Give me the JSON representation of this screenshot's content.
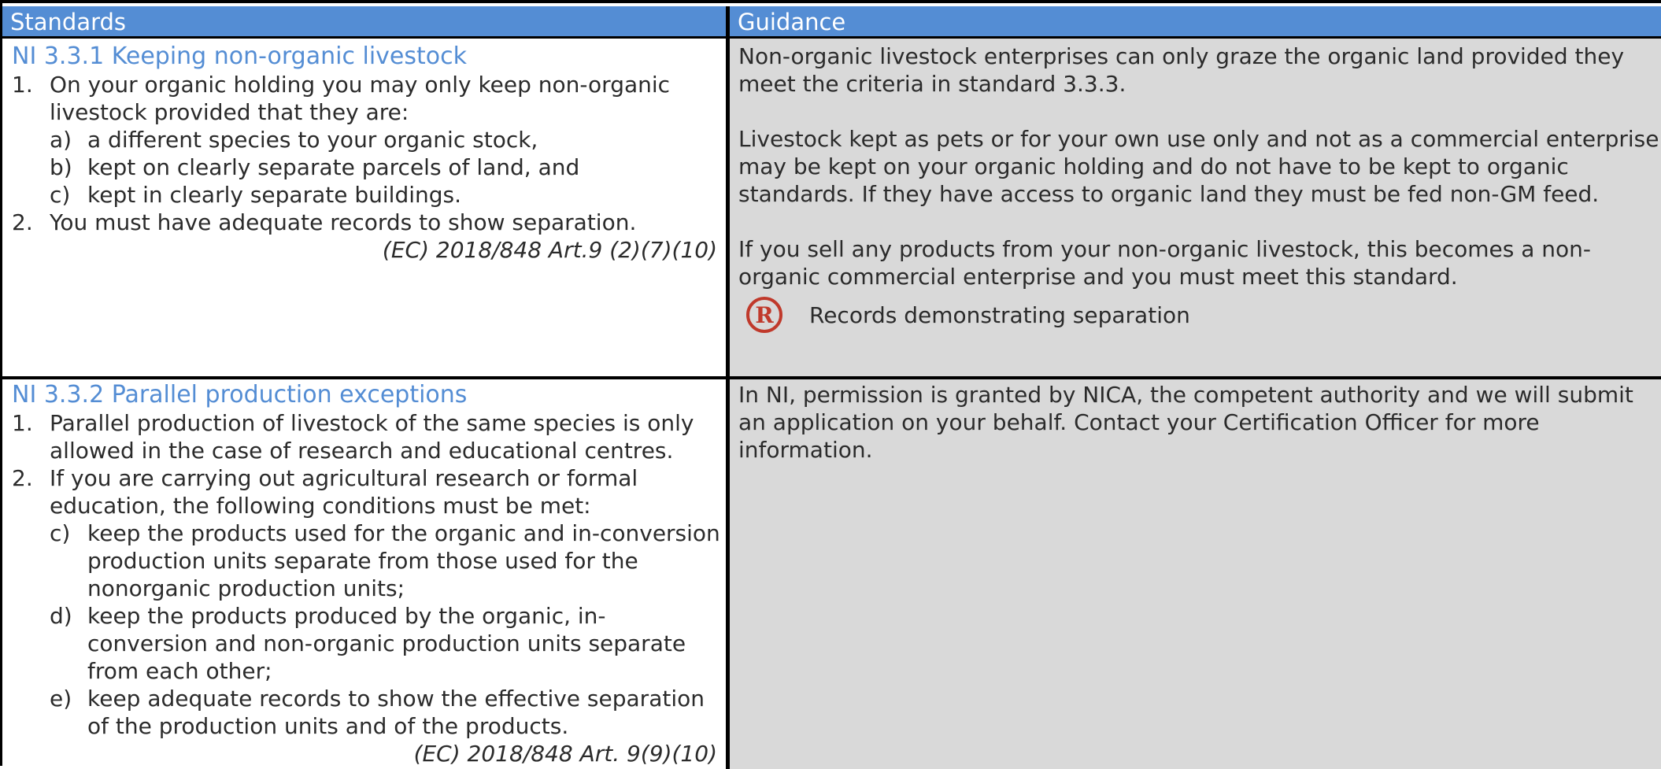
{
  "header": {
    "standards": "Standards",
    "guidance": "Guidance"
  },
  "section1": {
    "title": "NI 3.3.1 Keeping non-organic livestock",
    "items": [
      {
        "num": "1.",
        "text": "On your organic holding you may only keep non-organic livestock provided that they are:"
      },
      {
        "num": "2.",
        "text": "You must have adequate records to show separation."
      }
    ],
    "subitems": [
      {
        "num": "a)",
        "text": "a different species to your organic stock,"
      },
      {
        "num": "b)",
        "text": "kept on clearly separate parcels of land, and"
      },
      {
        "num": "c)",
        "text": "kept in clearly separate buildings."
      }
    ],
    "reference": "(EC) 2018/848 Art.9 (2)(7)(10)",
    "guidance": [
      "Non-organic livestock enterprises can only graze the organic land provided they meet the criteria in standard 3.3.3.",
      "Livestock kept as pets or for your own use only and not as a commercial enterprise may be kept on your organic holding and do not have to be kept to organic standards. If they have access to organic land they must be fed non-GM feed.",
      "If you sell any products from your non-organic livestock, this becomes a non-organic commercial enterprise and you must meet this standard."
    ],
    "records_icon": "R",
    "records_label": "Records demonstrating separation"
  },
  "section2": {
    "title": "NI 3.3.2 Parallel production exceptions",
    "items": [
      {
        "num": "1.",
        "text": "Parallel production of livestock of the same species is only allowed in the case of research and educational centres."
      },
      {
        "num": "2.",
        "text": "If you are carrying out agricultural research or formal education, the following conditions must be met:"
      }
    ],
    "subitems": [
      {
        "num": "c)",
        "text": "keep the products used for the organic and in-conversion production units separate from those used for the nonorganic production units;"
      },
      {
        "num": "d)",
        "text": "keep the products produced by the organic, in-conversion and non-organic production units separate from each other;"
      },
      {
        "num": "e)",
        "text": "keep adequate records to show the effective separation of the production units and of the products."
      }
    ],
    "reference": "(EC) 2018/848 Art. 9(9)(10)",
    "guidance": "In NI, permission is granted by NICA, the competent authority and we will submit an application on your behalf. Contact your Certification Officer for more information."
  }
}
